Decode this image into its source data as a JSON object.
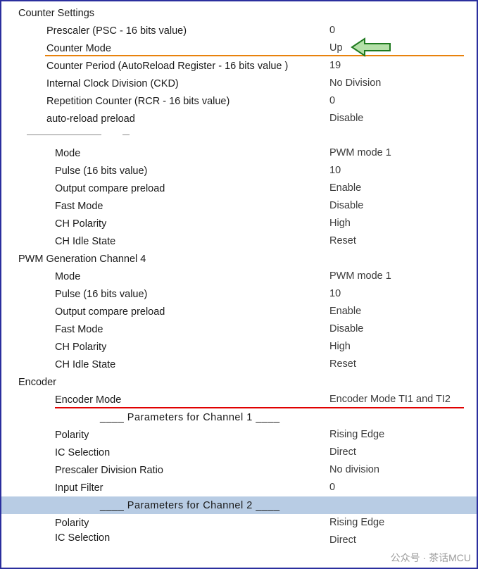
{
  "window": {
    "title": "Counter Settings",
    "watermark": "公众号 · 茶话MCU"
  },
  "colors": {
    "border": "#2b2f9e",
    "underline_orange": "#e8820c",
    "underline_red": "#e00000",
    "highlight_row": "#b8cce4",
    "arrow_fill": "#b4e0a8",
    "arrow_stroke": "#1f7a1f"
  },
  "rows": [
    {
      "label": "Prescaler (PSC - 16 bits value)",
      "value": "0",
      "level": 1
    },
    {
      "label": "Counter Mode",
      "value": "Up",
      "level": 1,
      "underline": "orange"
    },
    {
      "label": "Counter Period (AutoReload Register - 16 bits value )",
      "value": "19",
      "level": 1
    },
    {
      "label": "Internal Clock Division (CKD)",
      "value": "No Division",
      "level": 1
    },
    {
      "label": "Repetition Counter (RCR - 16 bits value)",
      "value": "0",
      "level": 1
    },
    {
      "label": "auto-reload preload",
      "value": "Disable",
      "level": 1
    },
    {
      "label": "Mode",
      "value": "PWM mode 1",
      "level": 2
    },
    {
      "label": "Pulse (16 bits value)",
      "value": "10",
      "level": 2
    },
    {
      "label": "Output compare preload",
      "value": "Enable",
      "level": 2
    },
    {
      "label": "Fast Mode",
      "value": "Disable",
      "level": 2
    },
    {
      "label": "CH Polarity",
      "value": "High",
      "level": 2
    },
    {
      "label": "CH Idle State",
      "value": "Reset",
      "level": 2
    },
    {
      "label": "PWM Generation Channel 4",
      "value": "",
      "level": 0
    },
    {
      "label": "Mode",
      "value": "PWM mode 1",
      "level": 2
    },
    {
      "label": "Pulse (16 bits value)",
      "value": "10",
      "level": 2
    },
    {
      "label": "Output compare preload",
      "value": "Enable",
      "level": 2
    },
    {
      "label": "Fast Mode",
      "value": "Disable",
      "level": 2
    },
    {
      "label": "CH Polarity",
      "value": "High",
      "level": 2
    },
    {
      "label": "CH Idle State",
      "value": "Reset",
      "level": 2
    },
    {
      "label": "Encoder",
      "value": "",
      "level": 0
    },
    {
      "label": "Encoder Mode",
      "value": "Encoder Mode TI1 and TI2",
      "level": 2,
      "underline": "red"
    },
    {
      "label": "____ Parameters for Channel 1 ____",
      "value": "",
      "level": 3
    },
    {
      "label": "Polarity",
      "value": "Rising Edge",
      "level": 2
    },
    {
      "label": "IC Selection",
      "value": "Direct",
      "level": 2
    },
    {
      "label": "Prescaler Division Ratio",
      "value": "No division",
      "level": 2
    },
    {
      "label": "Input Filter",
      "value": "0",
      "level": 2
    },
    {
      "label": "____ Parameters for Channel 2 ____",
      "value": "",
      "level": 3,
      "highlight": true
    },
    {
      "label": "Polarity",
      "value": "Rising Edge",
      "level": 2
    },
    {
      "label": "IC Selection",
      "value": "Direct",
      "level": 2,
      "clipped": true
    }
  ]
}
